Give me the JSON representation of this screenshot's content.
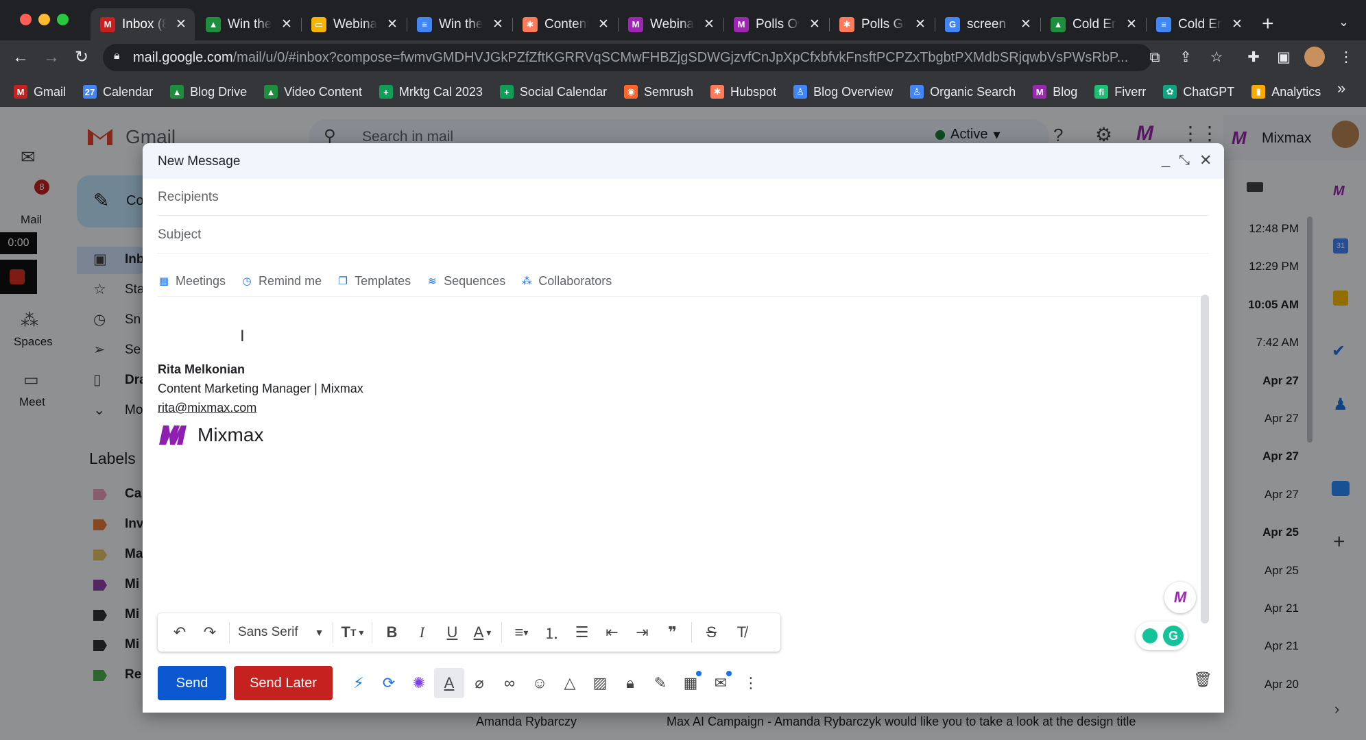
{
  "browser": {
    "tabs": [
      {
        "title": "Inbox (8",
        "favicon": "gmail-icon",
        "color": "#c5221f",
        "glyph": "M",
        "active": true
      },
      {
        "title": "Win the",
        "favicon": "drive-icon",
        "color": "#1e8e3e",
        "glyph": "▲"
      },
      {
        "title": "Webinar",
        "favicon": "slides-icon",
        "color": "#f4b400",
        "glyph": "▭"
      },
      {
        "title": "Win the",
        "favicon": "docs-icon",
        "color": "#4285f4",
        "glyph": "≡"
      },
      {
        "title": "Content",
        "favicon": "hubspot-icon",
        "color": "#ff7a59",
        "glyph": "✱"
      },
      {
        "title": "Webinar",
        "favicon": "mixmax-icon",
        "color": "#9c27b0",
        "glyph": "M"
      },
      {
        "title": "Polls Ov",
        "favicon": "mixmax-icon",
        "color": "#9c27b0",
        "glyph": "M"
      },
      {
        "title": "Polls Gif",
        "favicon": "hubspot-icon",
        "color": "#ff7a59",
        "glyph": "✱"
      },
      {
        "title": "screen r",
        "favicon": "google-icon",
        "color": "#4285f4",
        "glyph": "G"
      },
      {
        "title": "Cold Em",
        "favicon": "drive-icon",
        "color": "#1e8e3e",
        "glyph": "▲"
      },
      {
        "title": "Cold Em",
        "favicon": "docs-icon",
        "color": "#4285f4",
        "glyph": "≡"
      }
    ],
    "url_host": "mail.google.com",
    "url_rest": "/mail/u/0/#inbox?compose=fwmvGMDHVJGkPZfZftKGRRVqSCMwFHBZjgSDWGjzvfCnJpXpCfxbfvkFnsftPCPZxTbgbtPXMdbSRjqwbVsPWsRbP...",
    "bookmarks": [
      {
        "label": "Gmail",
        "icon": "gmail-icon",
        "color": "#c5221f",
        "glyph": "M"
      },
      {
        "label": "Calendar",
        "icon": "calendar-icon",
        "color": "#4285f4",
        "glyph": "27"
      },
      {
        "label": "Blog Drive",
        "icon": "drive-icon",
        "color": "#1e8e3e",
        "glyph": "▲"
      },
      {
        "label": "Video Content",
        "icon": "drive-icon",
        "color": "#1e8e3e",
        "glyph": "▲"
      },
      {
        "label": "Mrktg Cal 2023",
        "icon": "sheets-icon",
        "color": "#0f9d58",
        "glyph": "+"
      },
      {
        "label": "Social Calendar",
        "icon": "sheets-icon",
        "color": "#0f9d58",
        "glyph": "+"
      },
      {
        "label": "Semrush",
        "icon": "semrush-icon",
        "color": "#ff642d",
        "glyph": "◉"
      },
      {
        "label": "Hubspot",
        "icon": "hubspot-icon",
        "color": "#ff7a59",
        "glyph": "✱"
      },
      {
        "label": "Blog Overview",
        "icon": "person-icon",
        "color": "#4285f4",
        "glyph": "♙"
      },
      {
        "label": "Organic Search",
        "icon": "person-icon",
        "color": "#4285f4",
        "glyph": "♙"
      },
      {
        "label": "Blog",
        "icon": "mixmax-icon",
        "color": "#9c27b0",
        "glyph": "M"
      },
      {
        "label": "Fiverr",
        "icon": "fiverr-icon",
        "color": "#1dbf73",
        "glyph": "fi"
      },
      {
        "label": "ChatGPT",
        "icon": "chatgpt-icon",
        "color": "#10a37f",
        "glyph": "✿"
      },
      {
        "label": "Analytics",
        "icon": "analytics-icon",
        "color": "#f9ab00",
        "glyph": "▮"
      }
    ]
  },
  "gmail": {
    "app_name": "Gmail",
    "search_placeholder": "Search in mail",
    "status": "Active",
    "mixmax_label": "Mixmax",
    "rail": [
      {
        "label": "Mail",
        "badge": "8"
      },
      {
        "label": "Spaces"
      },
      {
        "label": "Meet"
      }
    ],
    "recording_timer": "0:00",
    "compose_label": "Co",
    "nav_fragments": [
      "Inb",
      "Sta",
      "Sn",
      "Se",
      "Dra",
      "Mo"
    ],
    "labels_heading": "Labels",
    "label_fragments": [
      {
        "text": "Ca",
        "color": "#e8a0b8"
      },
      {
        "text": "Inv",
        "color": "#e57c3d"
      },
      {
        "text": "Ma",
        "color": "#e6c36a"
      },
      {
        "text": "Mi",
        "color": "#8e44ad"
      },
      {
        "text": "Mi",
        "color": "#333333"
      },
      {
        "text": "Mi",
        "color": "#333333"
      },
      {
        "text": "Re",
        "color": "#4caf50"
      }
    ],
    "dates": [
      {
        "text": "12:48 PM",
        "bold": false
      },
      {
        "text": "12:29 PM",
        "bold": false
      },
      {
        "text": "10:05 AM",
        "bold": true
      },
      {
        "text": "7:42 AM",
        "bold": false
      },
      {
        "text": "Apr 27",
        "bold": true
      },
      {
        "text": "Apr 27",
        "bold": false
      },
      {
        "text": "Apr 27",
        "bold": true
      },
      {
        "text": "Apr 27",
        "bold": false
      },
      {
        "text": "Apr 25",
        "bold": true
      },
      {
        "text": "Apr 25",
        "bold": false
      },
      {
        "text": "Apr 21",
        "bold": false
      },
      {
        "text": "Apr 21",
        "bold": false
      },
      {
        "text": "Apr 20",
        "bold": false
      }
    ],
    "bottom_row": {
      "sender": "Amanda Rybarczy",
      "subject": "Max AI Campaign - Amanda Rybarczyk would like you to take a look at the design title"
    }
  },
  "compose": {
    "title": "New Message",
    "recipients_placeholder": "Recipients",
    "subject_placeholder": "Subject",
    "mixmax_tools": [
      {
        "label": "Meetings",
        "icon": "calendar-icon",
        "glyph": "▦"
      },
      {
        "label": "Remind me",
        "icon": "clock-icon",
        "glyph": "◷"
      },
      {
        "label": "Templates",
        "icon": "templates-icon",
        "glyph": "❐"
      },
      {
        "label": "Sequences",
        "icon": "sequences-icon",
        "glyph": "≋"
      },
      {
        "label": "Collaborators",
        "icon": "collaborators-icon",
        "glyph": "⁂"
      }
    ],
    "signature": {
      "name": "Rita Melkonian",
      "role": "Content Marketing Manager | Mixmax",
      "email": "rita@mixmax.com",
      "logo_text": "Mixmax"
    },
    "font_name": "Sans Serif",
    "send_label": "Send",
    "send_later_label": "Send Later"
  }
}
